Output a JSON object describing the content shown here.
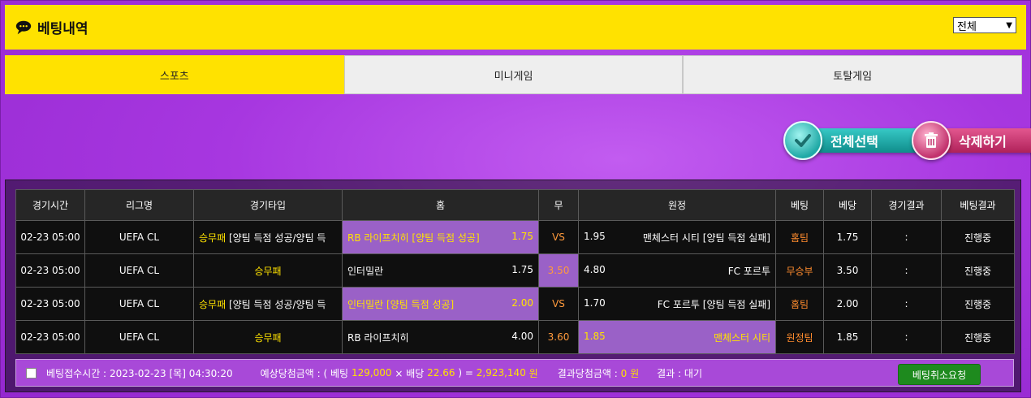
{
  "header": {
    "title": "베팅내역",
    "filter_value": "전체"
  },
  "tabs": [
    {
      "label": "스포츠",
      "active": true
    },
    {
      "label": "미니게임",
      "active": false
    },
    {
      "label": "토탈게임",
      "active": false
    }
  ],
  "actions": {
    "select_all": "전체선택",
    "delete": "삭제하기"
  },
  "table": {
    "columns": [
      "경기시간",
      "리그명",
      "경기타입",
      "홈",
      "무",
      "원정",
      "베팅",
      "베당",
      "경기결과",
      "베팅결과"
    ],
    "rows": [
      {
        "time": "02-23 05:00",
        "league": "UEFA CL",
        "type_main": "승무패",
        "type_rest": " [양팀 득점 성공/양팀 득",
        "home": "RB 라이프치히 [양팀 득점 성공]",
        "home_odds": "1.75",
        "draw": "VS",
        "away_odds": "1.95",
        "away": "맨체스터 시티 [양팀 득점 실패]",
        "bet": "홈팀",
        "bet_odds": "1.75",
        "result": ":",
        "status": "진행중"
      },
      {
        "time": "02-23 05:00",
        "league": "UEFA CL",
        "type_main": "승무패",
        "type_rest": "",
        "home": "인터밀란",
        "home_odds": "1.75",
        "draw": "3.50",
        "away_odds": "4.80",
        "away": "FC 포르투",
        "bet": "무승부",
        "bet_odds": "3.50",
        "result": ":",
        "status": "진행중"
      },
      {
        "time": "02-23 05:00",
        "league": "UEFA CL",
        "type_main": "승무패",
        "type_rest": " [양팀 득점 성공/양팀 득",
        "home": "인터밀란 [양팀 득점 성공]",
        "home_odds": "2.00",
        "draw": "VS",
        "away_odds": "1.70",
        "away": "FC 포르투 [양팀 득점 실패]",
        "bet": "홈팀",
        "bet_odds": "2.00",
        "result": ":",
        "status": "진행중"
      },
      {
        "time": "02-23 05:00",
        "league": "UEFA CL",
        "type_main": "승무패",
        "type_rest": "",
        "home": "RB 라이프치히",
        "home_odds": "4.00",
        "draw": "3.60",
        "away_odds": "1.85",
        "away": "맨체스터 시티",
        "bet": "원정팀",
        "bet_odds": "1.85",
        "result": ":",
        "status": "진행중"
      }
    ]
  },
  "footer": {
    "received_label": "베팅접수시간 :",
    "received_value": "2023-02-23 [목] 04:30:20",
    "expected_label": "예상당첨금액 : ( 베팅",
    "bet_amount": "129,000",
    "times": "× 배당",
    "odds_total": "22.66",
    "equals": ") =",
    "expected_amount": "2,923,140",
    "won": "원",
    "result_amount_label": "결과당첨금액 :",
    "result_amount": "0 원",
    "result_label": "결과 :",
    "result_value": "대기",
    "cancel_button": "베팅취소요청"
  },
  "colors": {
    "accent_yellow": "#ffe200",
    "selected_cell": "#9a61c7",
    "draw_orange": "#ff9a3c",
    "cancel_green": "#1e8a1e"
  }
}
